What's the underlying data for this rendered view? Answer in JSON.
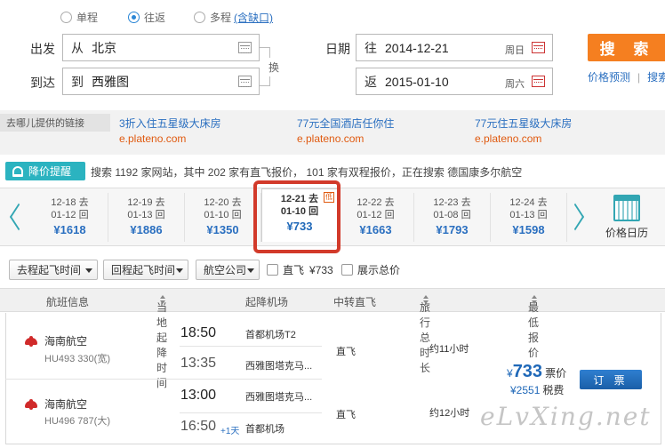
{
  "trip_type": {
    "options": [
      "单程",
      "往返",
      "多程"
    ],
    "selected": "往返",
    "multi_link": "(含缺口)"
  },
  "form": {
    "from_label": "出发",
    "from_prefix": "从",
    "from_value": "北京",
    "to_label": "到达",
    "to_prefix": "到",
    "to_value": "西雅图",
    "swap": "换",
    "date_label": "日期",
    "depart_prefix": "往",
    "depart_date": "2014-12-21",
    "depart_weekday": "周日",
    "return_prefix": "返",
    "return_date": "2015-01-10",
    "return_weekday": "周六"
  },
  "search_button": "搜 索",
  "top_links": [
    "价格预测",
    "搜索"
  ],
  "ads": {
    "tag": "去哪儿提供的链接",
    "items": [
      {
        "title": "3折入住五星级大床房",
        "url": "e.plateno.com"
      },
      {
        "title": "77元全国酒店任你住",
        "url": "e.plateno.com"
      },
      {
        "title": "77元住五星级大床房",
        "url": "e.plateno.com"
      }
    ]
  },
  "alert": {
    "button": "降价提醒",
    "status": "搜索 1192 家网站，其中 202 家有直飞报价， 101 家有双程报价，正在搜索 德国康多尔航空"
  },
  "date_strip": {
    "days": [
      {
        "go": "12-18 去",
        "back": "01-12 回",
        "price": "¥1618"
      },
      {
        "go": "12-19 去",
        "back": "01-13 回",
        "price": "¥1886"
      },
      {
        "go": "12-20 去",
        "back": "01-10 回",
        "price": "¥1350"
      },
      {
        "go": "12-21 去",
        "back": "01-10 回",
        "price": "¥733"
      },
      {
        "go": "12-22 去",
        "back": "01-12 回",
        "price": "¥1663"
      },
      {
        "go": "12-23 去",
        "back": "01-08 回",
        "price": "¥1793"
      },
      {
        "go": "12-24 去",
        "back": "01-13 回",
        "price": "¥1598"
      }
    ],
    "selected_index": 3,
    "low_tag": "低",
    "calendar_label": "价格日历"
  },
  "filters": {
    "depart_time": "去程起飞时间",
    "return_time": "回程起飞时间",
    "airline": "航空公司",
    "direct_label": "直飞",
    "direct_price": "¥733",
    "show_total": "展示总价"
  },
  "table": {
    "headers": [
      "航班信息",
      "当地起降时间",
      "起降机场",
      "中转直飞",
      "旅行总时长",
      "最低报价"
    ]
  },
  "result": {
    "legs": [
      {
        "airline": "海南航空",
        "flight": "HU493 330(宽)",
        "dep_time": "18:50",
        "arr_time": "13:35",
        "plus_day": "",
        "dep_airport": "首都机场T2",
        "arr_airport": "西雅图塔克马...",
        "transfer": "直飞",
        "duration": "约11小时"
      },
      {
        "airline": "海南航空",
        "flight": "HU496 787(大)",
        "dep_time": "13:00",
        "arr_time": "16:50",
        "plus_day": "+1天",
        "dep_airport": "西雅图塔克马...",
        "arr_airport": "首都机场",
        "transfer": "直飞",
        "duration": "约12小时"
      }
    ],
    "price_symbol": "¥",
    "price": "733",
    "price_label": "票价",
    "tax": "¥2551",
    "tax_label": "税费",
    "book": "订 票"
  },
  "watermark": "eLvXing.net"
}
